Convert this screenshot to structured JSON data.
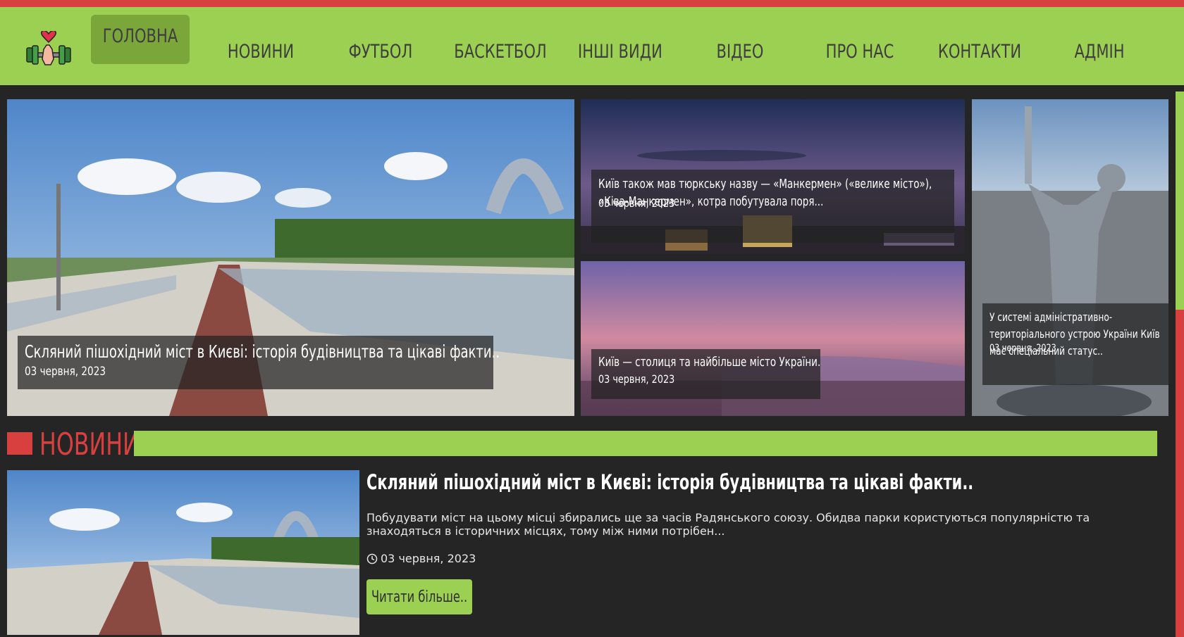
{
  "colors": {
    "accent_green": "#9cd052",
    "accent_red": "#d84040",
    "dark_bg": "#252525"
  },
  "nav": {
    "logo_icon": "heart-dumbbell-icon",
    "items": [
      {
        "label": "ГОЛОВНА",
        "active": true
      },
      {
        "label": "НОВИНИ"
      },
      {
        "label": "ФУТБОЛ"
      },
      {
        "label": "БАСКЕТБОЛ"
      },
      {
        "label": "ІНШІ ВИДИ"
      },
      {
        "label": "ВІДЕО"
      },
      {
        "label": "ПРО НАС"
      },
      {
        "label": "КОНТАКТИ"
      },
      {
        "label": "АДМІН"
      }
    ]
  },
  "featured": [
    {
      "title": "Скляний пішохідний міст в Києві: історія будівництва та цікаві факти..",
      "date": "03 червня, 2023"
    },
    {
      "title": "Київ також мав тюркську назву — «Манкермен» («велике місто»), «Ківа-Манкермен», котра побутувала поря...",
      "date": "03 червня, 2023"
    },
    {
      "title": "Київ — столиця та найбільше місто України.",
      "date": "03 червня, 2023"
    },
    {
      "title": "У системі адміністративно-територіального устрою України Київ має спеціальний статус..",
      "date": "03 червня, 2023"
    }
  ],
  "news_section": {
    "heading": "НОВИНИ",
    "items": [
      {
        "title": "Скляний пішохідний міст в Києві: історія будівництва та цікаві факти..",
        "excerpt": "Побудувати міст на цьому місці збирались ще за часів Радянського союзу. Обидва парки користуються популярністю та знаходяться в історичних місцях, тому між ними потрібен...",
        "date": "03 червня, 2023",
        "button": "Читати більше.."
      }
    ]
  }
}
